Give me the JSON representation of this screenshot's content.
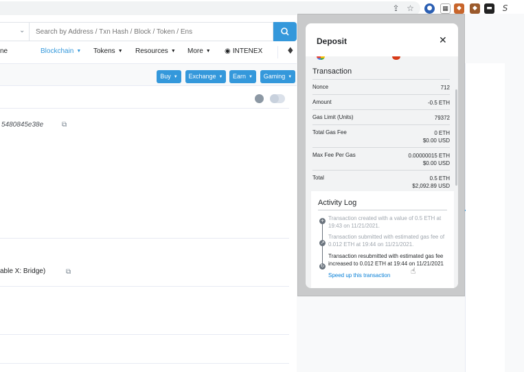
{
  "browser": {
    "share_icon": "share-icon",
    "bookmark_icon": "star-icon",
    "more_label": "S"
  },
  "search": {
    "placeholder": "Search by Address / Txn Hash / Block / Token / Ens",
    "selector_caret": "⌄",
    "button_icon": "search-icon"
  },
  "nav": {
    "items": [
      {
        "label": "ne"
      },
      {
        "label": "Blockchain"
      },
      {
        "label": "Tokens"
      },
      {
        "label": "Resources"
      },
      {
        "label": "More"
      },
      {
        "label": "INTENEX"
      }
    ]
  },
  "sponsored": {
    "buttons": [
      {
        "label": "Buy"
      },
      {
        "label": "Exchange"
      },
      {
        "label": "Earn"
      },
      {
        "label": "Gaming"
      }
    ]
  },
  "page": {
    "hash_fragment": "5480845e38e",
    "bridge_text": "able X: Bridge)"
  },
  "popup": {
    "title": "Deposit",
    "close": "✕",
    "section_title": "Transaction",
    "rows": [
      {
        "label": "Nonce",
        "value": "712",
        "value2": ""
      },
      {
        "label": "Amount",
        "value": "-0.5 ETH",
        "value2": ""
      },
      {
        "label": "Gas Limit (Units)",
        "value": "79372",
        "value2": ""
      },
      {
        "label": "Total Gas Fee",
        "value": "0 ETH",
        "value2": "$0.00 USD"
      },
      {
        "label": "Max Fee Per Gas",
        "value": "0.00000015 ETH",
        "value2": "$0.00 USD"
      },
      {
        "label": "Total",
        "value": "0.5 ETH",
        "value2": "$2,092.89 USD"
      }
    ],
    "activity": {
      "title": "Activity Log",
      "entries": [
        {
          "text": "Transaction created with a value of 0.5 ETH at 19:43 on 11/21/2021.",
          "icon": "+"
        },
        {
          "text": "Transaction submitted with estimated gas fee of 0.012 ETH at 19:44 on 11/21/2021.",
          "icon": "↗"
        },
        {
          "text": "Transaction resubmitted with estimated gas fee increased to 0.012 ETH at 19:44 on 11/21/2021",
          "icon": "↻"
        }
      ],
      "speed_up": "Speed up this transaction"
    }
  }
}
